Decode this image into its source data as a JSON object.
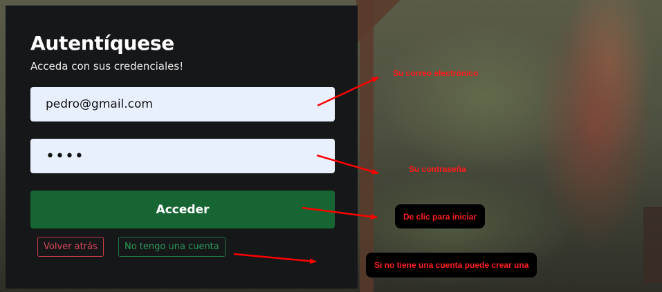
{
  "login": {
    "title": "Autentíquese",
    "subtitle": "Acceda con sus credenciales!",
    "email_value": "pedro@gmail.com",
    "password_masked": "••••",
    "submit_label": "Acceder",
    "back_label": "Volver atrás",
    "no_account_label": "No tengo una cuenta"
  },
  "annotations": {
    "email_note": "Su correo electrónico",
    "password_note": "Su contraseña",
    "submit_note": "De clic para iniciar",
    "signup_note": "Si no tiene una cuenta puede crear una"
  },
  "colors": {
    "panel_bg": "#161719",
    "field_bg": "#e8f0fe",
    "primary_button": "#176533",
    "back_button": "#c93a48",
    "no_account_button": "#1f7a44",
    "annotation_text": "#ff1a1a"
  }
}
